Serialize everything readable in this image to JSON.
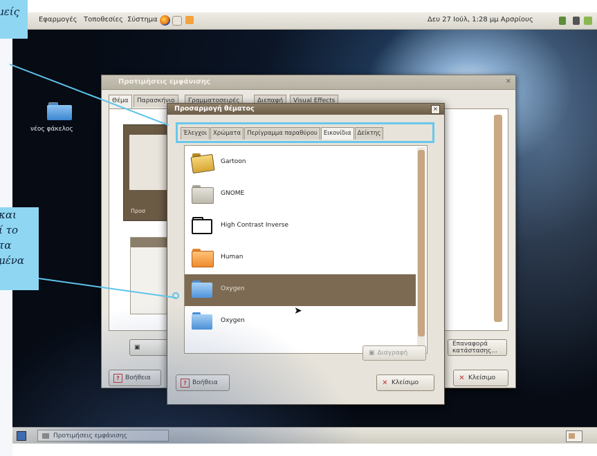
{
  "callouts": {
    "top": "μείς",
    "mid": [
      "και",
      "ί το",
      "τα",
      "μένα"
    ]
  },
  "panel": {
    "menu_applications": "Εφαρμογές",
    "menu_places": "Τοποθεσίες",
    "menu_system": "Σύστημα",
    "clock": "Δευ 27 Ιούλ, 1:28 μμ Αρσρίους"
  },
  "desktop": {
    "folder_label": "νέος φάκελος"
  },
  "appearance_window": {
    "title": "Προτιμήσεις εμφάνισης",
    "tabs": [
      "Θέμα",
      "Παρασκήνιο",
      "Γραμματοσειρές",
      "Διεπαφή",
      "Visual Effects"
    ],
    "thumb_label": "Προσ",
    "restore_button": "Επαναφορά κατάστασης...",
    "help_button": "Βοήθεια",
    "close_button": "Κλείσιμο"
  },
  "customize_dialog": {
    "title": "Προσαρμογή θέματος",
    "tabs": [
      "Έλεγχοι",
      "Χρώματα",
      "Περίγραμμα παραθύρου",
      "Εικονίδια",
      "Δείκτης"
    ],
    "active_tab": "Εικονίδια",
    "icon_themes": [
      "Gartoon",
      "GNOME",
      "High Contrast Inverse",
      "Human",
      "Oxygen",
      "Oxygen"
    ],
    "selected_theme": "Oxygen",
    "delete_button": "Διαγραφή",
    "help_button": "Βοήθεια",
    "close_button": "Κλείσιμο"
  },
  "taskbar": {
    "window_button": "Προτιμήσεις εμφάνισης"
  },
  "colors": {
    "selection": "#7d6a53",
    "callout": "#8fd6f2",
    "callout_line": "#5ec3e9",
    "titlebar": "#6c5d49"
  }
}
